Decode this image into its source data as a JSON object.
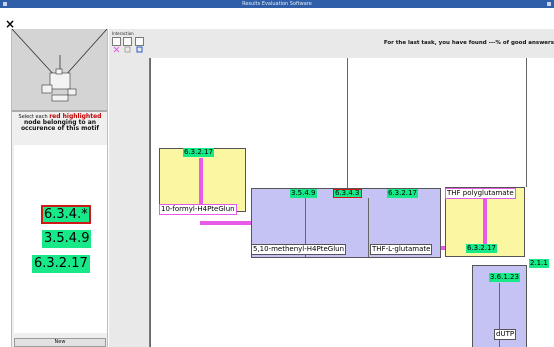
{
  "window": {
    "title": "Results Evaluation Software"
  },
  "menubar": {
    "close_glyph": "×"
  },
  "left_panel": {
    "instructions": {
      "prefix": "Select each",
      "highlight": "red highlighted",
      "suffix": "node belonging to an occurence of this motif"
    },
    "motif_labels": [
      {
        "text": "6.3.4.*",
        "selected": true
      },
      {
        "text": "3.5.4.9",
        "selected": false
      },
      {
        "text": "6.3.2.17",
        "selected": false
      }
    ],
    "new_button": "New"
  },
  "toolbar": {
    "label": "Interaction",
    "status": "For the last task, you have found ---% of good answers"
  },
  "graph": {
    "node_left": {
      "tag": "6.3.2.17",
      "name": "10-formyl-H4PteGlun"
    },
    "node_center": {
      "tags": [
        {
          "text": "3.5.4.9",
          "selected": false
        },
        {
          "text": "6.3.4.3",
          "selected": true
        },
        {
          "text": "6.3.2.17",
          "selected": false
        }
      ],
      "names": [
        "5,10-methenyl-H4PteGlun",
        "THF-L-glutamate"
      ]
    },
    "node_right": {
      "name": "THF polyglutamate",
      "tag": "6.3.2.17"
    },
    "node_bottom": {
      "tag": "3.6.1.23",
      "name": "dUTP",
      "edge_tag": "2.1.1"
    }
  },
  "colors": {
    "highlight_green": "#17e888",
    "selection_red": "#d01818",
    "edge_magenta": "#e85be8",
    "node_yellow": "#fbf6a2",
    "node_lilac": "#c5c3f4"
  }
}
